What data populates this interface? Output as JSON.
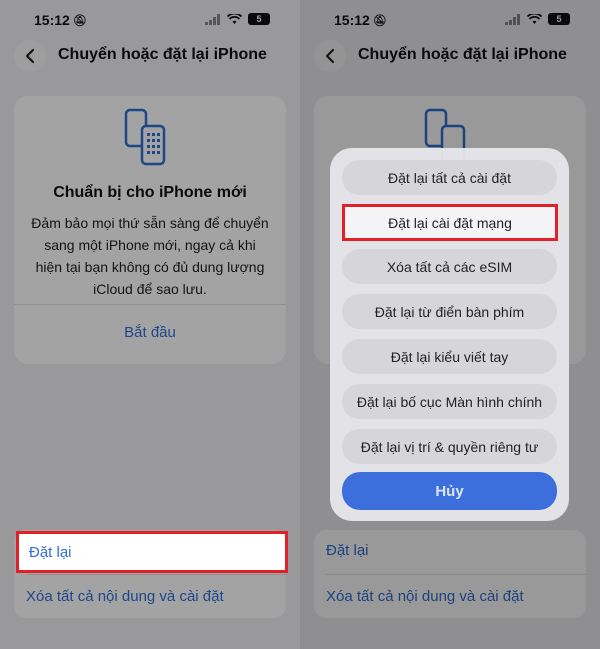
{
  "status": {
    "time": "15:12",
    "battery": "5"
  },
  "nav": {
    "title": "Chuyển hoặc đặt lại iPhone"
  },
  "card": {
    "title": "Chuẩn bị cho iPhone mới",
    "description": "Đảm bảo mọi thứ sẵn sàng để chuyển sang một iPhone mới, ngay cả khi hiện tại bạn không có đủ dung lượng iCloud để sao lưu.",
    "action": "Bắt đầu"
  },
  "list": {
    "reset": "Đặt lại",
    "erase": "Xóa tất cả nội dung và cài đặt"
  },
  "sheet": {
    "options": [
      "Đặt lại tất cả cài đặt",
      "Đặt lại cài đặt mạng",
      "Xóa tất cả các eSIM",
      "Đặt lại từ điển bàn phím",
      "Đặt lại kiểu viết tay",
      "Đặt lại bố cục Màn hình chính",
      "Đặt lại vị trí & quyền riêng tư"
    ],
    "cancel": "Hủy"
  },
  "colors": {
    "accent": "#2f6fd6",
    "highlight": "#e1202a",
    "cancel_bg": "#3d6fdc"
  }
}
